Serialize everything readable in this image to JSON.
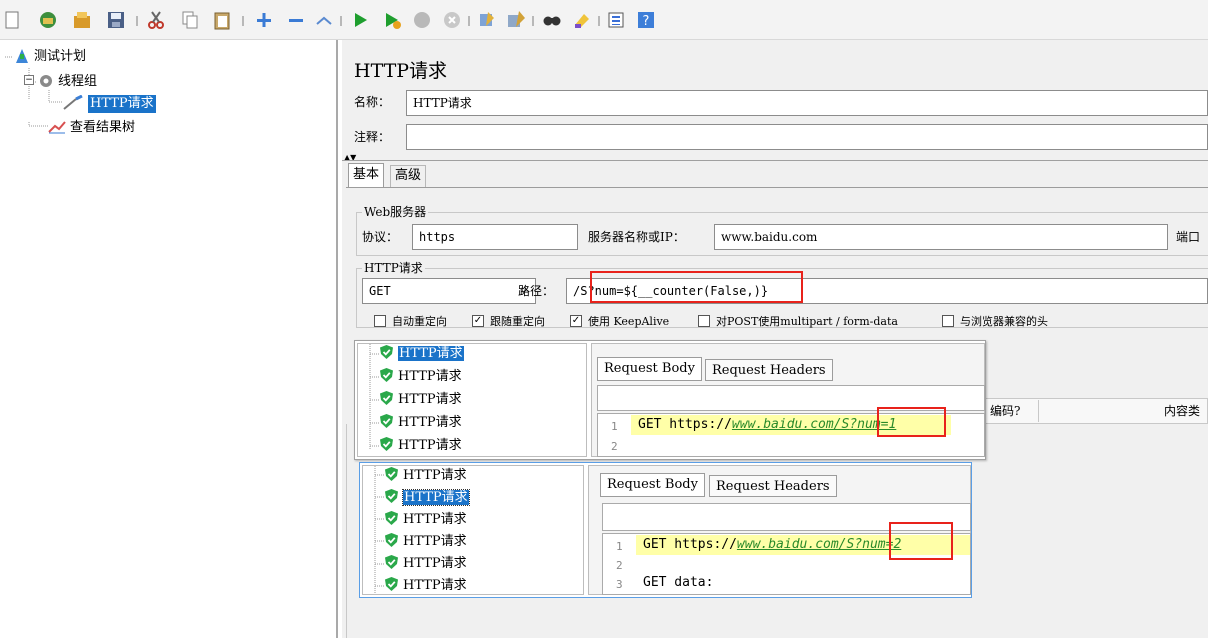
{
  "tree": {
    "test_plan": "测试计划",
    "thread_group": "线程组",
    "http_request": "HTTP请求",
    "result_tree": "查看结果树"
  },
  "sampler": {
    "title": "HTTP请求",
    "name_label": "名称：",
    "name_value": "HTTP请求",
    "comment_label": "注释：",
    "comment_value": "",
    "tabs": [
      "基本",
      "高级"
    ],
    "web_server_legend": "Web服务器",
    "protocol_label": "协议：",
    "protocol_value": "https",
    "server_label": "服务器名称或IP：",
    "server_value": "www.baidu.com",
    "port_label": "端口",
    "http_request_legend": "HTTP请求",
    "method_value": "GET",
    "path_label": "路径：",
    "path_value": "/S?num=${__counter(False,)}",
    "checkboxes": [
      {
        "label": "自动重定向",
        "checked": false
      },
      {
        "label": "跟随重定向",
        "checked": true
      },
      {
        "label": "使用 KeepAlive",
        "checked": true
      },
      {
        "label": "对POST使用multipart / form-data",
        "checked": false
      },
      {
        "label": "与浏览器兼容的头",
        "checked": false
      }
    ],
    "table_headers": [
      "编码?",
      "内容类"
    ]
  },
  "popup1": {
    "items": [
      "HTTP请求",
      "HTTP请求",
      "HTTP请求",
      "HTTP请求",
      "HTTP请求"
    ],
    "tabs": [
      "Request Body",
      "Request Headers"
    ],
    "line1_num": "1",
    "line2_num": "2",
    "line1_prefix": "GET https://",
    "line1_url": "www.baidu.com/S",
    "line1_query": "?num=1"
  },
  "popup2": {
    "items": [
      "HTTP请求",
      "HTTP请求",
      "HTTP请求",
      "HTTP请求",
      "HTTP请求",
      "HTTP请求"
    ],
    "tabs": [
      "Request Body",
      "Request Headers"
    ],
    "line1_num": "1",
    "line2_num": "2",
    "line3_num": "3",
    "line1_prefix": "GET https://",
    "line1_url": "www.baidu.com/S",
    "line1_query": "?num=2",
    "line3_text": "GET data:"
  },
  "colors": {
    "selection": "#1a73c9",
    "highlight": "#ffffa8",
    "annotation": "#e8221b",
    "shield": "#2aa84a"
  }
}
